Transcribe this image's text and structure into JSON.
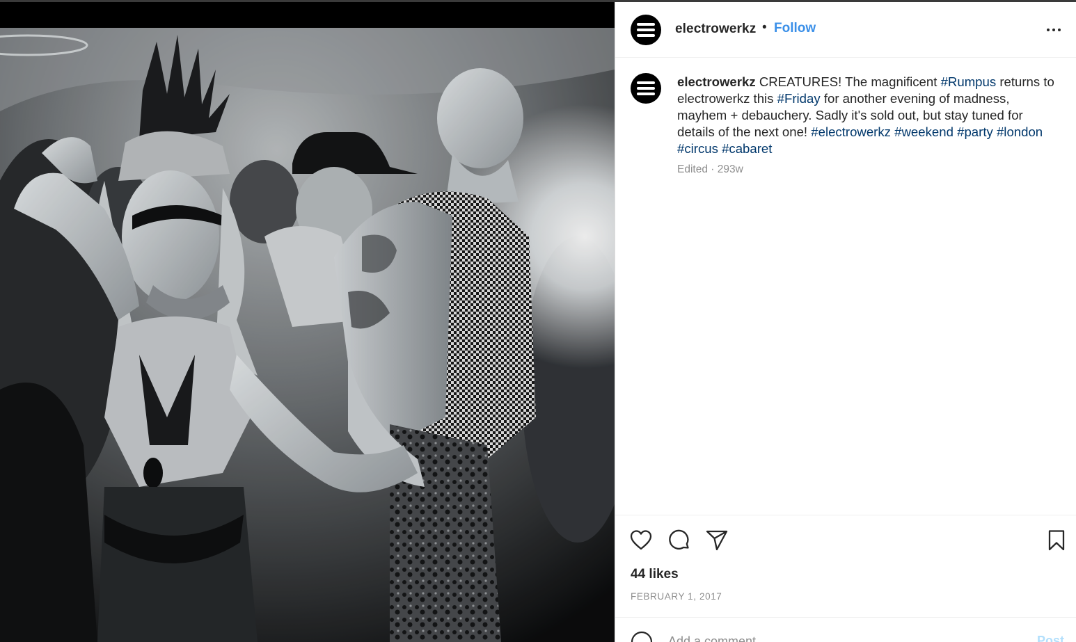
{
  "header": {
    "username": "electrowerkz",
    "separator": "•",
    "follow_label": "Follow"
  },
  "caption": {
    "username": "electrowerkz",
    "segments": [
      " CREATURES! The magnificent ",
      "#Rumpus",
      " returns to electrowerkz this ",
      "#Friday",
      " for another evening of madness, mayhem + debauchery. Sadly it's sold out, but stay tuned for details of the next one! ",
      "#electrowerkz",
      " ",
      "#weekend",
      " ",
      "#party",
      " ",
      "#london",
      " ",
      "#circus",
      " ",
      "#cabaret"
    ],
    "meta": "Edited · 293w"
  },
  "actions": {
    "icons": [
      "heart-icon",
      "comment-icon",
      "share-icon",
      "bookmark-icon"
    ],
    "likes": "44 likes",
    "date": "FEBRUARY 1, 2017"
  },
  "comment": {
    "placeholder": "Add a comment...",
    "post_label": "Post"
  },
  "colors": {
    "link_blue": "#3a8fe8",
    "hashtag": "#00376b",
    "text": "#262626",
    "muted": "#8e8e8e"
  }
}
